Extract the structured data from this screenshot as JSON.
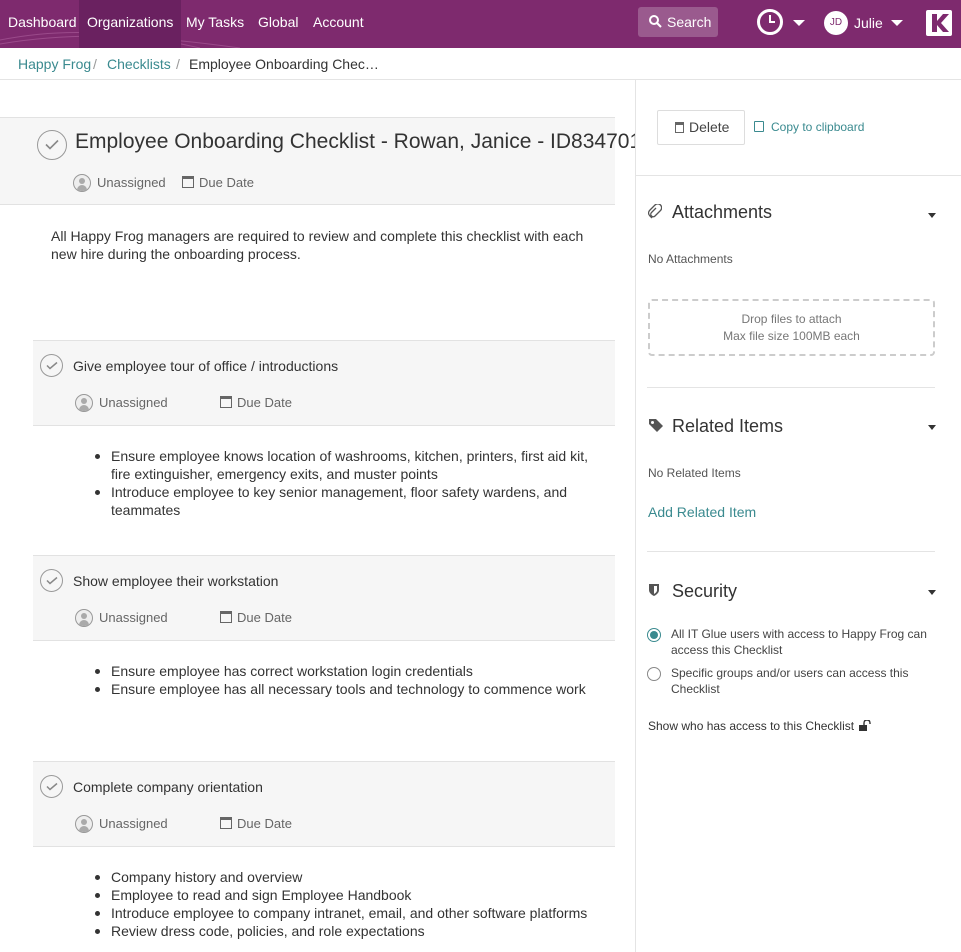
{
  "nav": {
    "items": [
      "Dashboard",
      "Organizations",
      "My Tasks",
      "Global",
      "Account"
    ],
    "search_label": "Search",
    "user_initials": "JD",
    "user_name": "Julie",
    "brand_color": "#7e2a6e"
  },
  "breadcrumb": [
    "Happy Frog",
    "Checklists",
    "Employee Onboarding Chec…"
  ],
  "checklist": {
    "title": "Employee Onboarding Checklist - Rowan, Janice - ID834701",
    "assignee": "Unassigned",
    "due_date": "Due Date",
    "description": "All Happy Frog managers are required to review and complete this checklist with each new hire during the onboarding process."
  },
  "tasks": [
    {
      "title": "Give employee tour of office / introductions",
      "assignee": "Unassigned",
      "due_date": "Due Date",
      "bullets": [
        "Ensure employee knows location of washrooms, kitchen, printers, first aid kit, fire extinguisher, emergency exits, and muster points",
        "Introduce employee to key senior management, floor safety wardens, and teammates"
      ]
    },
    {
      "title": "Show employee their workstation",
      "assignee": "Unassigned",
      "due_date": "Due Date",
      "bullets": [
        "Ensure employee has correct workstation login credentials",
        "Ensure employee has all necessary tools and technology to commence work"
      ]
    },
    {
      "title": "Complete company orientation",
      "assignee": "Unassigned",
      "due_date": "Due Date",
      "bullets": [
        "Company history and overview",
        "Employee to read and sign Employee Handbook",
        "Introduce employee to company intranet, email, and other software platforms",
        "Review dress code, policies, and role expectations"
      ]
    }
  ],
  "sidebar": {
    "delete_label": "Delete",
    "copy_label": "Copy to clipboard",
    "attachments": {
      "title": "Attachments",
      "empty": "No Attachments",
      "drop_line1": "Drop files to attach",
      "drop_line2": "Max file size 100MB each"
    },
    "related": {
      "title": "Related Items",
      "empty": "No Related Items",
      "add_label": "Add Related Item"
    },
    "security": {
      "title": "Security",
      "option_all": "All IT Glue users with access to Happy Frog can access this Checklist",
      "option_specific": "Specific groups and/or users can access this Checklist",
      "selected": "all",
      "show_access": "Show who has access to this Checklist"
    }
  },
  "colors": {
    "link": "#3a8a8f",
    "nav_active": "#6a2160"
  }
}
